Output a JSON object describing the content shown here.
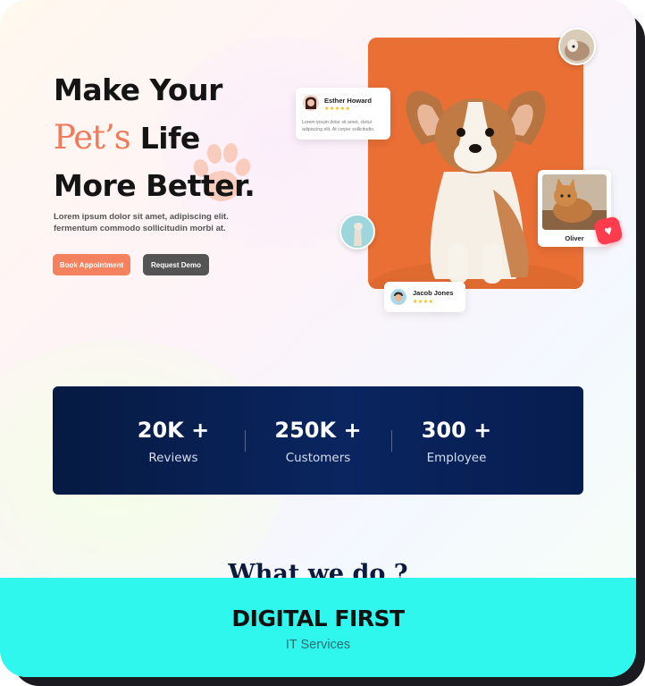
{
  "hero": {
    "title_line1": "Make Your",
    "title_accent": "Pet’s",
    "title_line2_rest": " Life",
    "title_line3": "More Better.",
    "description": "Lorem ipsum dolor sit amet, adipiscing elit. fermentum commodo sollicitudin morbi at.",
    "primary_button": "Book Appointment",
    "secondary_button": "Request Demo"
  },
  "reviews": [
    {
      "name": "Esther Howard",
      "stars": "★★★★★",
      "text": "Lorem ipsum dolor sit amet, ctetur adipiscing elit. At corper sollicitudin."
    },
    {
      "name": "Jacob Jones",
      "stars": "★★★★"
    }
  ],
  "cat_card": {
    "name": "Oliver"
  },
  "stats": [
    {
      "value": "20K +",
      "label": "Reviews"
    },
    {
      "value": "250K +",
      "label": "Customers"
    },
    {
      "value": "300 +",
      "label": "Employee"
    }
  ],
  "next_section": {
    "heading": "What we do ?"
  },
  "banner": {
    "title": "DIGITAL FIRST",
    "subtitle": "IT Services"
  },
  "colors": {
    "accent": "#f07a5b",
    "primary_button": "#f5825f",
    "stats_bg": "#0a2560",
    "banner_bg": "#2ff7ed"
  },
  "icons": [
    "paw-icon",
    "heart-icon",
    "star-icon"
  ]
}
